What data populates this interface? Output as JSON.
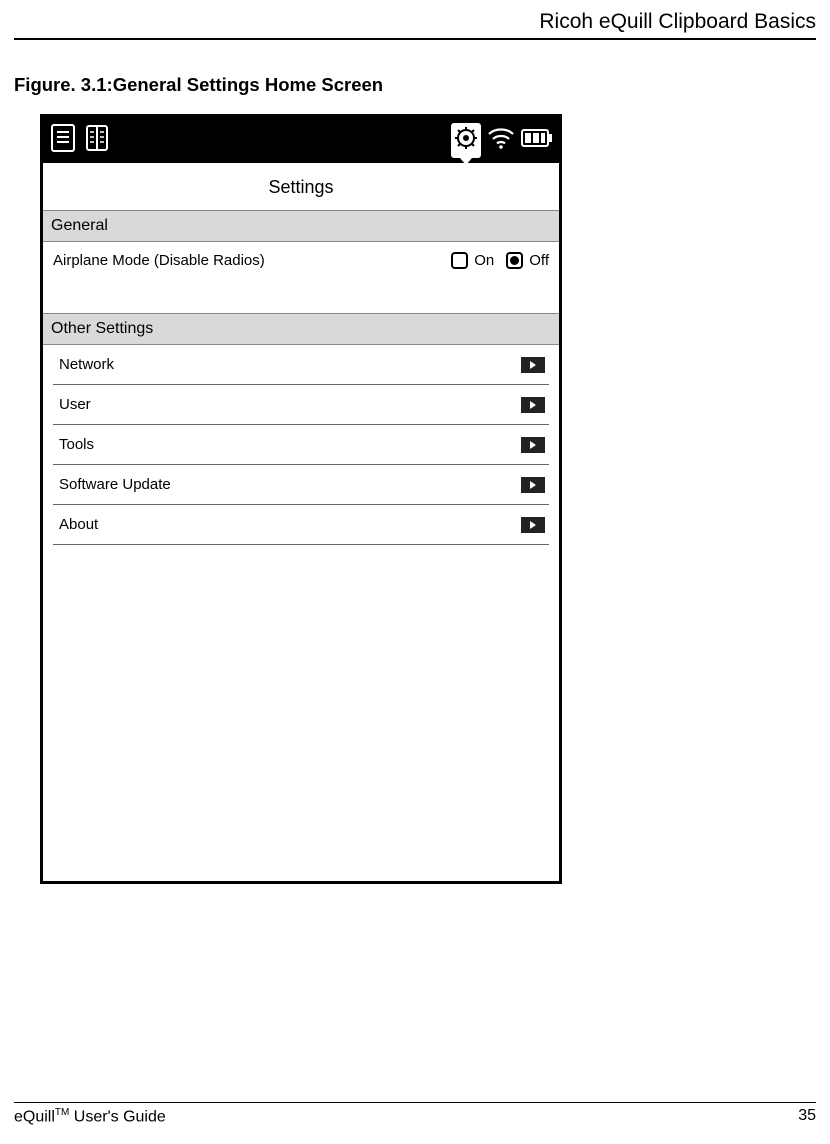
{
  "header": {
    "running_title": "Ricoh eQuill Clipboard Basics"
  },
  "figure": {
    "caption": "Figure. 3.1:General Settings Home Screen"
  },
  "panel": {
    "title": "Settings",
    "sections": {
      "general": {
        "header": "General",
        "airplane_label": "Airplane Mode (Disable Radios)",
        "on_label": "On",
        "off_label": "Off"
      },
      "other": {
        "header": "Other Settings",
        "items": [
          {
            "label": "Network"
          },
          {
            "label": "User"
          },
          {
            "label": "Tools"
          },
          {
            "label": "Software Update"
          },
          {
            "label": "About"
          }
        ]
      }
    }
  },
  "status_icons": {
    "left": [
      "document-icon",
      "pages-icon"
    ],
    "right": [
      "settings-icon",
      "wifi-icon",
      "battery-icon"
    ]
  },
  "footer": {
    "guide_prefix": "eQuill",
    "guide_tm": "TM",
    "guide_suffix": " User's Guide",
    "page_number": "35"
  }
}
